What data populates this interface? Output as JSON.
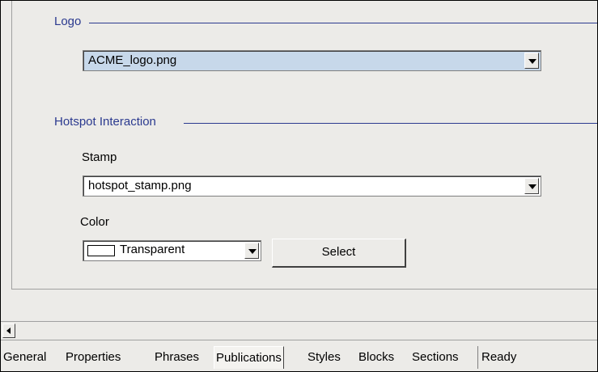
{
  "logo_section": {
    "legend": "Logo",
    "selected_file": "ACME_logo.png"
  },
  "hotspot_section": {
    "legend": "Hotspot Interaction",
    "stamp_label": "Stamp",
    "stamp_value": "hotspot_stamp.png",
    "color_label": "Color",
    "color_value": "Transparent",
    "select_button": "Select"
  },
  "tabs": [
    {
      "label": "General"
    },
    {
      "label": "Properties"
    },
    {
      "label": "Phrases"
    },
    {
      "label": "Publications",
      "active": true
    },
    {
      "label": "Styles"
    },
    {
      "label": "Blocks"
    },
    {
      "label": "Sections"
    }
  ],
  "status": "Ready"
}
